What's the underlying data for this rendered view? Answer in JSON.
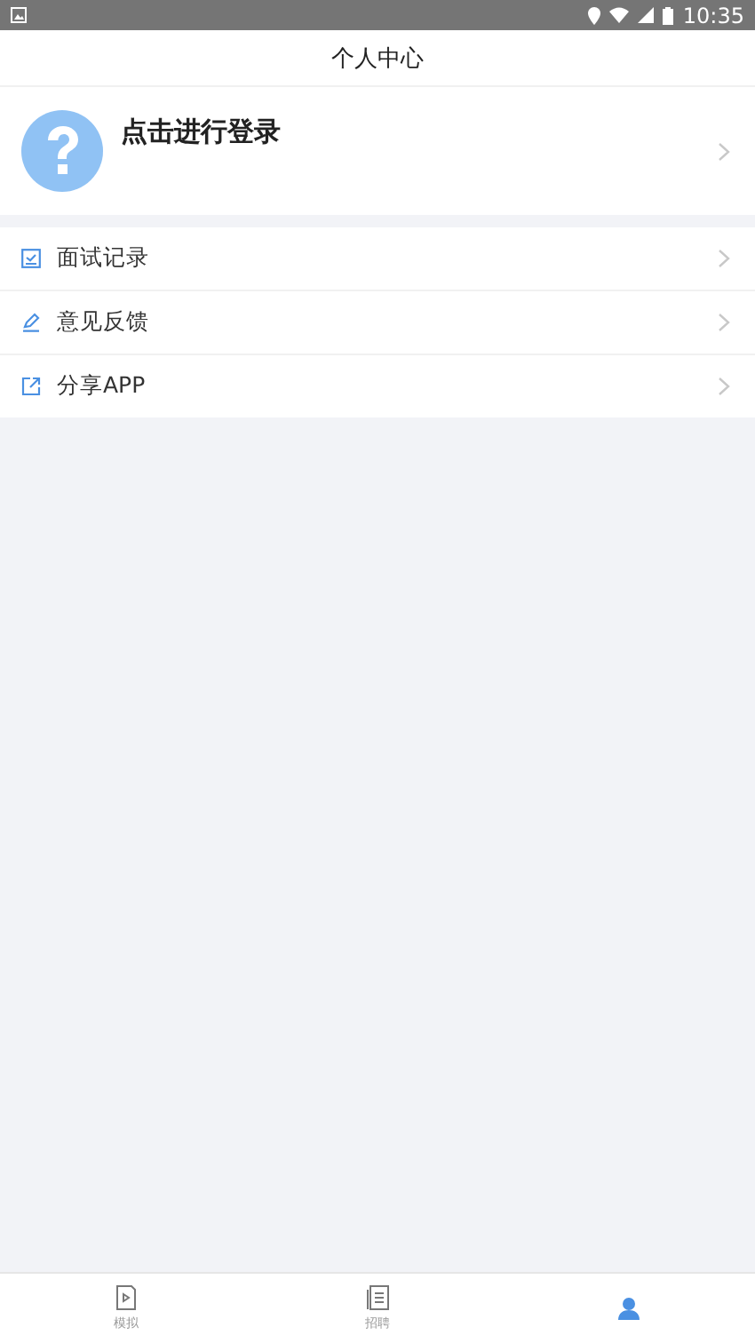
{
  "status_bar": {
    "time": "10:35"
  },
  "header": {
    "title": "个人中心"
  },
  "profile": {
    "login_prompt": "点击进行登录"
  },
  "menu": [
    {
      "kind": "record",
      "label": "面试记录"
    },
    {
      "kind": "feedback",
      "label": "意见反馈"
    },
    {
      "kind": "share",
      "label": "分享APP"
    }
  ],
  "tab_bar": [
    {
      "kind": "mock",
      "label": "模拟",
      "selected": false
    },
    {
      "kind": "jobs",
      "label": "招聘",
      "selected": false
    },
    {
      "kind": "me",
      "selected": true
    }
  ]
}
